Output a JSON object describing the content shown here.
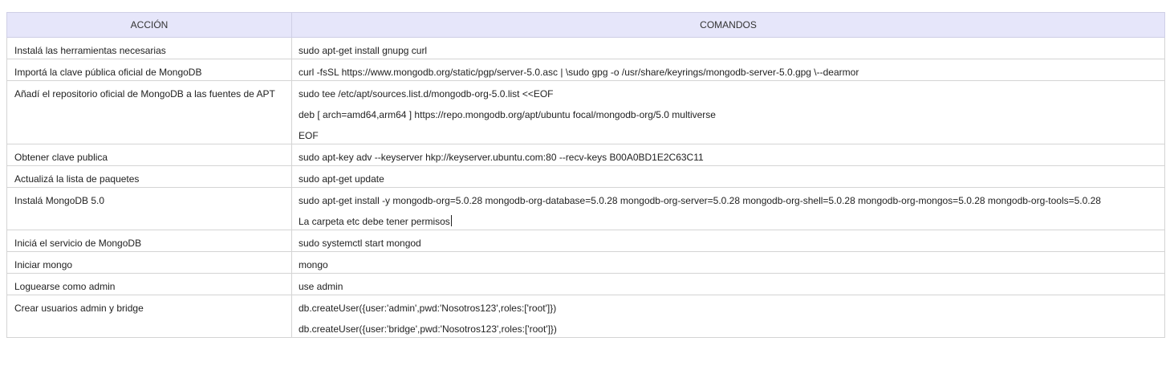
{
  "table": {
    "headers": [
      "ACCIÓN",
      "COMANDOS"
    ],
    "rows": [
      {
        "action": "Instalá las herramientas necesarias",
        "commands": [
          "sudo apt-get install gnupg curl"
        ]
      },
      {
        "action": "Importá la clave pública oficial de MongoDB",
        "commands": [
          "curl -fsSL https://www.mongodb.org/static/pgp/server-5.0.asc | \\sudo gpg -o /usr/share/keyrings/mongodb-server-5.0.gpg \\--dearmor"
        ]
      },
      {
        "action": "Añadí el repositorio oficial de MongoDB a las fuentes de APT",
        "commands": [
          "sudo tee /etc/apt/sources.list.d/mongodb-org-5.0.list <<EOF",
          "deb [ arch=amd64,arm64 ] https://repo.mongodb.org/apt/ubuntu focal/mongodb-org/5.0 multiverse",
          "EOF"
        ]
      },
      {
        "action": "Obtener clave publica",
        "commands": [
          "sudo apt-key adv --keyserver hkp://keyserver.ubuntu.com:80 --recv-keys B00A0BD1E2C63C11"
        ]
      },
      {
        "action": "Actualizá la lista de paquetes",
        "commands": [
          "sudo apt-get update"
        ]
      },
      {
        "action": "Instalá MongoDB 5.0",
        "commands": [
          "sudo apt-get install -y mongodb-org=5.0.28 mongodb-org-database=5.0.28 mongodb-org-server=5.0.28 mongodb-org-shell=5.0.28 mongodb-org-mongos=5.0.28 mongodb-org-tools=5.0.28",
          "La carpeta etc debe tener permisos"
        ]
      },
      {
        "action": "Iniciá el servicio de MongoDB",
        "commands": [
          "sudo systemctl start mongod"
        ]
      },
      {
        "action": "Iniciar mongo",
        "commands": [
          "mongo"
        ]
      },
      {
        "action": "Loguearse como admin",
        "commands": [
          "use admin"
        ]
      },
      {
        "action": "Crear usuarios admin y bridge",
        "commands": [
          "db.createUser({user:'admin',pwd:'Nosotros123',roles:['root']})",
          "db.createUser({user:'bridge',pwd:'Nosotros123',roles:['root']})"
        ]
      }
    ]
  }
}
